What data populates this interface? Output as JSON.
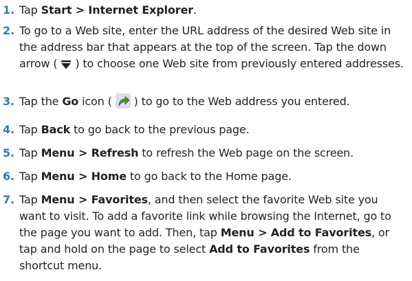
{
  "steps": [
    {
      "num": "1.",
      "a": "Tap ",
      "b1": "Start > Internet Explorer",
      "c": "."
    },
    {
      "num": "2.",
      "a": "To go to a Web site, enter the URL address of the desired Web site in the address bar that appears at the top of the screen. Tap the down arrow ( ",
      "icon": "down-arrow-icon",
      "c": " ) to choose one Web site from previously entered addresses."
    },
    {
      "num": "3.",
      "a": "Tap the ",
      "b1": "Go",
      "mid": " icon ( ",
      "icon": "go-icon",
      "c": " ) to go to the Web address you entered."
    },
    {
      "num": "4.",
      "a": "Tap ",
      "b1": "Back",
      "c": " to go back to the previous page."
    },
    {
      "num": "5.",
      "a": "Tap ",
      "b1": "Menu > Refresh",
      "c": " to refresh the Web page on the screen."
    },
    {
      "num": "6.",
      "a": "Tap ",
      "b1": "Menu > Home",
      "c": " to go back to the Home page."
    },
    {
      "num": "7.",
      "a": "Tap ",
      "b1": "Menu > Favorites",
      "c": ", and then select the favorite Web site you want to visit. To add a favorite link while browsing the Internet, go to the page you want to add. Then, tap ",
      "b2": "Menu > Add to Favorites",
      "d": ", or tap and hold on the page to select ",
      "b3": "Add to Favorites",
      "e": " from the shortcut menu."
    }
  ],
  "colors": {
    "number": "#2b7bbd",
    "text": "#231f20",
    "go_icon_bg": "#e4d8f3",
    "go_icon_arrow": "#3a9a2a"
  }
}
